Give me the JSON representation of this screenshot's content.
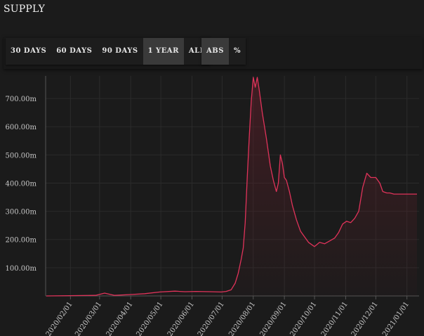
{
  "page": {
    "title": "SUPPLY"
  },
  "controls": {
    "ranges": [
      {
        "label": "30 DAYS",
        "active": false
      },
      {
        "label": "60 DAYS",
        "active": false
      },
      {
        "label": "90 DAYS",
        "active": false
      },
      {
        "label": "1 YEAR",
        "active": true
      },
      {
        "label": "ALL",
        "active": false
      }
    ],
    "modes": [
      {
        "label": "ABS",
        "active": true
      },
      {
        "label": "%",
        "active": false
      }
    ]
  },
  "colors": {
    "line": "#e0335a",
    "area_top": "#5a1e28",
    "grid": "#2b2b2b",
    "axis": "#555555",
    "text": "#c8c8c8"
  },
  "chart_data": {
    "type": "area",
    "title": "",
    "xlabel": "",
    "ylabel": "",
    "ylim": [
      0,
      780
    ],
    "y_ticks": [
      100,
      200,
      300,
      400,
      500,
      600,
      700
    ],
    "y_tick_labels": [
      "100.00m",
      "200.00m",
      "300.00m",
      "400.00m",
      "500.00m",
      "600.00m",
      "700.00m"
    ],
    "x_tick_labels": [
      "2020/02/01",
      "2020/03/01",
      "2020/04/01",
      "2020/05/01",
      "2020/06/01",
      "2020/07/01",
      "2020/08/01",
      "2020/09/01",
      "2020/10/01",
      "2020/11/01",
      "2020/12/01",
      "2021/01/01"
    ],
    "grid": true,
    "series": [
      {
        "x": [
          "2020/01/08",
          "2020/01/31",
          "2020/02/26",
          "2020/03/06",
          "2020/03/16",
          "2020/04/01",
          "2020/04/15",
          "2020/04/30",
          "2020/05/15",
          "2020/05/25",
          "2020/06/05",
          "2020/06/20",
          "2020/06/30",
          "2020/07/05",
          "2020/07/10",
          "2020/07/14",
          "2020/07/17",
          "2020/07/20",
          "2020/07/22",
          "2020/07/24",
          "2020/07/26",
          "2020/07/28",
          "2020/07/30",
          "2020/08/01",
          "2020/08/03",
          "2020/08/05",
          "2020/08/07",
          "2020/08/10",
          "2020/08/14",
          "2020/08/18",
          "2020/08/21",
          "2020/08/24",
          "2020/08/26",
          "2020/08/28",
          "2020/08/30",
          "2020/09/01",
          "2020/09/03",
          "2020/09/06",
          "2020/09/09",
          "2020/09/13",
          "2020/09/17",
          "2020/09/21",
          "2020/09/25",
          "2020/10/01",
          "2020/10/06",
          "2020/10/11",
          "2020/10/16",
          "2020/10/21",
          "2020/10/25",
          "2020/10/29",
          "2020/11/02",
          "2020/11/06",
          "2020/11/10",
          "2020/11/14",
          "2020/11/18",
          "2020/11/22",
          "2020/11/26",
          "2020/12/01",
          "2020/12/05",
          "2020/12/08",
          "2020/12/12",
          "2020/12/15",
          "2020/12/19",
          "2020/12/23",
          "2020/12/27",
          "2021/01/01",
          "2021/01/05",
          "2021/01/08",
          "2021/01/11"
        ],
        "values": [
          0,
          1,
          2,
          10,
          2,
          5,
          8,
          14,
          17,
          15,
          16,
          15,
          14,
          16,
          22,
          45,
          80,
          130,
          170,
          260,
          420,
          560,
          690,
          775,
          740,
          775,
          730,
          650,
          560,
          460,
          410,
          370,
          400,
          500,
          470,
          420,
          410,
          370,
          320,
          270,
          230,
          210,
          190,
          175,
          190,
          185,
          195,
          205,
          225,
          255,
          265,
          260,
          275,
          300,
          385,
          435,
          420,
          420,
          400,
          370,
          365,
          365,
          361,
          361,
          361,
          361,
          361,
          361,
          361
        ]
      }
    ]
  }
}
